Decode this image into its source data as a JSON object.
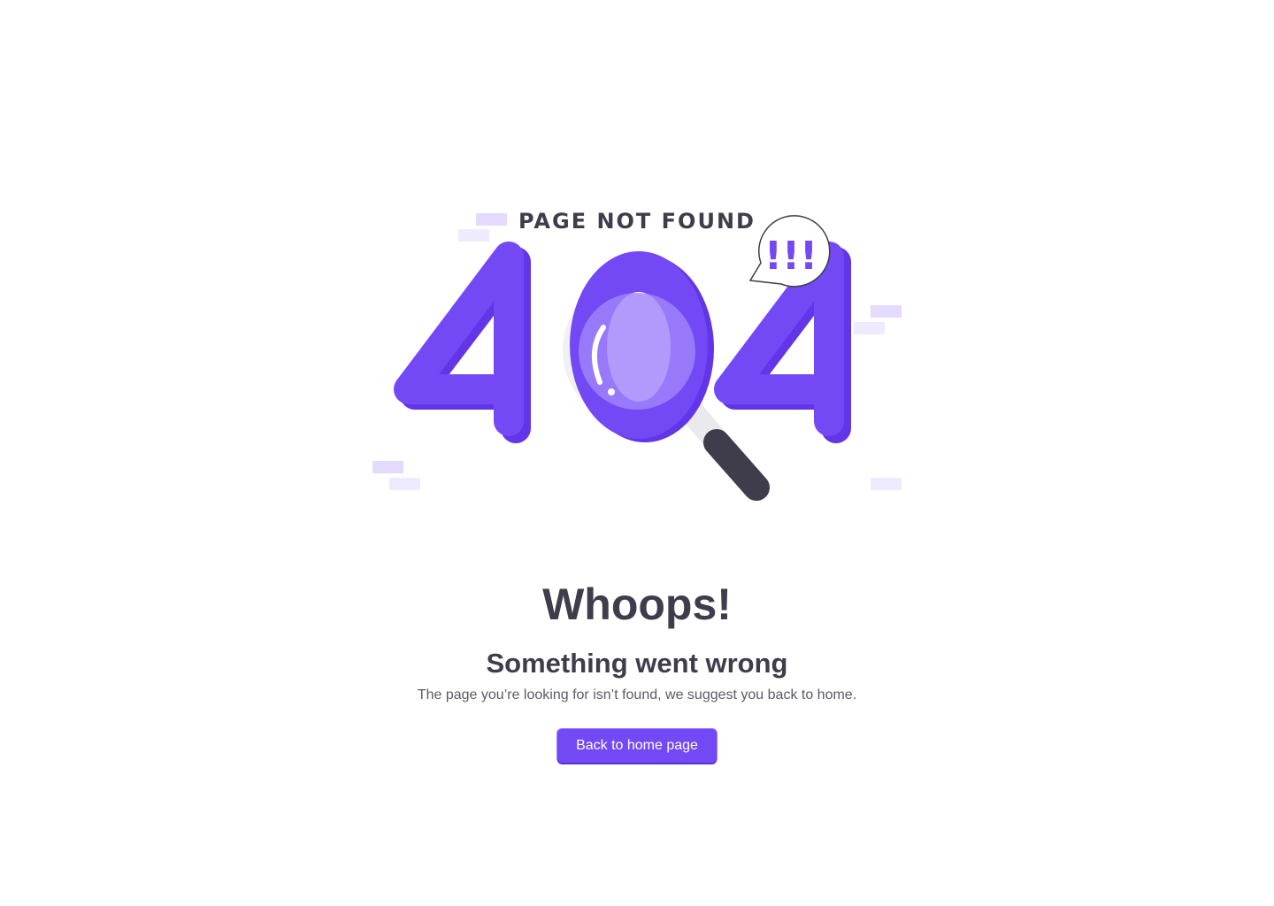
{
  "illustration": {
    "caption": "PAGE NOT FOUND",
    "digits": [
      "4",
      "0",
      "4"
    ],
    "speech_bubble_text": "!!!",
    "colors": {
      "primary": "#7349f5",
      "primary_dark": "#6236e8",
      "lens": "#a084fb",
      "handle": "#3f3d4b",
      "decor": "#e6defd"
    }
  },
  "main": {
    "headline": "Whoops!",
    "subheadline": "Something went wrong",
    "description": "The page you’re looking for isn’t found, we suggest you back to home.",
    "button_label": "Back to home page"
  }
}
